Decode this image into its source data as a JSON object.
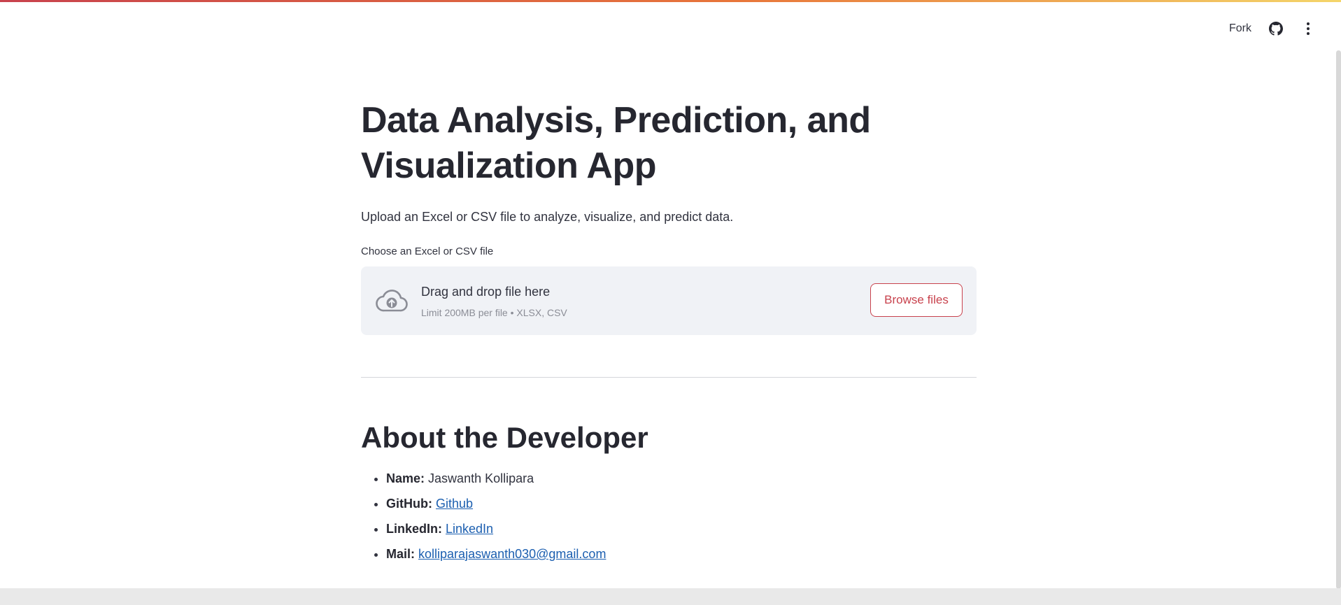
{
  "header": {
    "fork_label": "Fork",
    "github_icon": "github-icon",
    "menu_icon": "more-vertical-icon"
  },
  "main": {
    "title": "Data Analysis, Prediction, and Visualization App",
    "subtitle": "Upload an Excel or CSV file to analyze, visualize, and predict data.",
    "uploader": {
      "label": "Choose an Excel or CSV file",
      "drop_text": "Drag and drop file here",
      "limit_text": "Limit 200MB per file • XLSX, CSV",
      "browse_label": "Browse files",
      "icon": "cloud-upload-icon"
    }
  },
  "about": {
    "heading": "About the Developer",
    "items": [
      {
        "label": "Name:",
        "value": "Jaswanth Kollipara",
        "is_link": false
      },
      {
        "label": "GitHub:",
        "value": "Github",
        "is_link": true
      },
      {
        "label": "LinkedIn:",
        "value": "LinkedIn",
        "is_link": true
      },
      {
        "label": "Mail:",
        "value": "kolliparajaswanth030@gmail.com",
        "is_link": true
      }
    ]
  },
  "colors": {
    "accent": "#c8424d",
    "link": "#1c5fb0",
    "text": "#31333f",
    "dropzone_bg": "#f0f2f6"
  }
}
